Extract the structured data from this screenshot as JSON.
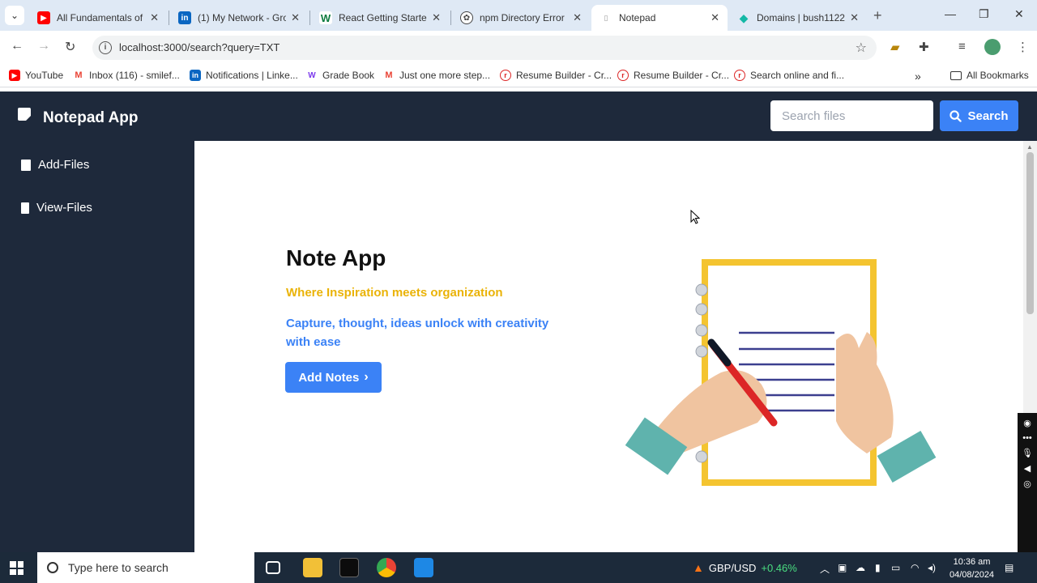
{
  "browser": {
    "tabs": [
      {
        "title": "All Fundamentals of",
        "favicon": "youtube-icon",
        "color": "#ff0000",
        "active": false
      },
      {
        "title": "(1) My Network - Gro",
        "favicon": "linkedin-icon",
        "color": "#0a66c2",
        "active": false
      },
      {
        "title": "React Getting Started",
        "favicon": "w-icon",
        "color": "#0b7a3e",
        "active": false
      },
      {
        "title": "npm Directory Error",
        "favicon": "openai-icon",
        "color": "#444444",
        "active": false
      },
      {
        "title": "Notepad",
        "favicon": "page-icon",
        "color": "#999999",
        "active": true
      },
      {
        "title": "Domains | bush1122",
        "favicon": "diamond-icon",
        "color": "#14b8a6",
        "active": false
      }
    ],
    "url": "localhost:3000/search?query=TXT",
    "bookmarks": [
      {
        "label": "YouTube",
        "color": "#ff0000"
      },
      {
        "label": "Inbox (116) - smilef...",
        "color": "#ea4335"
      },
      {
        "label": "Notifications | Linke...",
        "color": "#0a66c2"
      },
      {
        "label": "Grade Book",
        "color": "#7c3aed"
      },
      {
        "label": "Just one more step...",
        "color": "#ea4335"
      },
      {
        "label": "Resume Builder - Cr...",
        "color": "#dc2626"
      },
      {
        "label": "Resume Builder - Cr...",
        "color": "#dc2626"
      },
      {
        "label": "Search online and fi...",
        "color": "#dc2626"
      }
    ],
    "all_bookmarks": "All Bookmarks"
  },
  "app": {
    "title": "Notepad App",
    "search_placeholder": "Search files",
    "search_button": "Search",
    "sidebar": [
      {
        "label": "Add-Files"
      },
      {
        "label": "View-Files"
      }
    ],
    "hero": {
      "title": "Note App",
      "tagline": "Where Inspiration meets organization",
      "description": "Capture, thought, ideas unlock with creativity with ease",
      "button": "Add Notes"
    },
    "colors": {
      "header_bg": "#1e293b",
      "accent": "#3b82f6",
      "tagline": "#eab308"
    }
  },
  "taskbar": {
    "search_placeholder": "Type here to search",
    "ticker_pair": "GBP/USD",
    "ticker_change": "+0.46%",
    "time": "10:36 am",
    "date": "04/08/2024"
  }
}
